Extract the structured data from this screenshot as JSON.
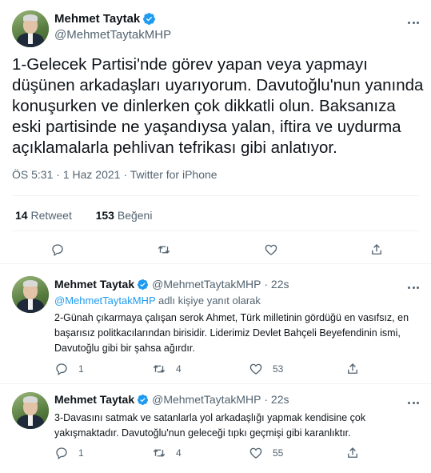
{
  "main_tweet": {
    "display_name": "Mehmet Taytak",
    "handle": "@MehmetTaytakMHP",
    "text": "1-Gelecek Partisi'nde görev yapan veya yapmayı düşünen arkadaşları uyarıyorum. Davutoğlu'nun yanında konuşurken ve dinlerken çok dikkatli olun. Baksanıza eski partisinde ne yaşandıysa yalan, iftira ve uydurma açıklamalarla pehlivan tefrikası gibi anlatıyor.",
    "time": "ÖS 5:31",
    "date": "1 Haz 2021",
    "source": "Twitter for iPhone",
    "retweet_count": "14",
    "retweet_label": "Retweet",
    "like_count": "153",
    "like_label": "Beğeni"
  },
  "replies": [
    {
      "display_name": "Mehmet Taytak",
      "handle": "@MehmetTaytakMHP",
      "age": "22s",
      "reply_to_handle": "@MehmetTaytakMHP",
      "reply_to_suffix": "adlı kişiye yanıt olarak",
      "text": "2-Günah çıkarmaya çalışan serok Ahmet, Türk milletinin gördüğü en vasıfsız, en başarısız politkacılarından birisidir. Liderimiz Devlet Bahçeli Beyefendinin ismi, Davutoğlu gibi bir şahsa ağırdır.",
      "reply_count": "1",
      "retweet_count": "4",
      "like_count": "53"
    },
    {
      "display_name": "Mehmet Taytak",
      "handle": "@MehmetTaytakMHP",
      "age": "22s",
      "text": "3-Davasını satmak ve satanlarla yol arkadaşlığı yapmak kendisine çok yakışmaktadır. Davutoğlu'nun geleceği tıpkı geçmişi gibi karanlıktır.",
      "reply_count": "1",
      "retweet_count": "4",
      "like_count": "55"
    }
  ],
  "colors": {
    "verified": "#1d9bf0",
    "secondary_text": "#536471",
    "link": "#1d9bf0",
    "divider": "#eff3f4"
  },
  "icons": [
    "verified-badge-icon",
    "more-icon",
    "reply-icon",
    "retweet-icon",
    "like-icon",
    "share-icon"
  ]
}
